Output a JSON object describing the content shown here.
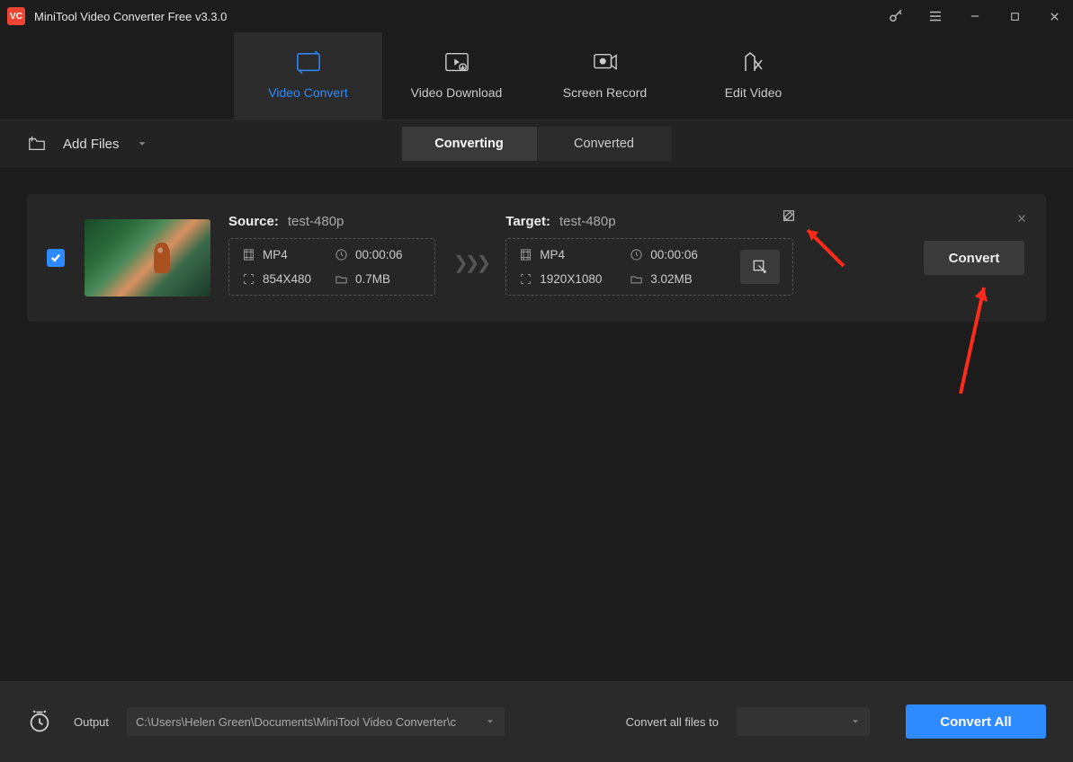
{
  "app": {
    "title": "MiniTool Video Converter Free v3.3.0",
    "logo_text": "VC"
  },
  "nav": {
    "items": [
      {
        "label": "Video Convert"
      },
      {
        "label": "Video Download"
      },
      {
        "label": "Screen Record"
      },
      {
        "label": "Edit Video"
      }
    ]
  },
  "toolbar": {
    "add_files": "Add Files",
    "sub_tabs": {
      "converting": "Converting",
      "converted": "Converted"
    }
  },
  "task": {
    "source_label": "Source:",
    "source_name": "test-480p",
    "source": {
      "format": "MP4",
      "duration": "00:00:06",
      "resolution": "854X480",
      "size": "0.7MB"
    },
    "target_label": "Target:",
    "target_name": "test-480p",
    "target": {
      "format": "MP4",
      "duration": "00:00:06",
      "resolution": "1920X1080",
      "size": "3.02MB"
    },
    "convert_label": "Convert"
  },
  "bottom": {
    "output_label": "Output",
    "output_path": "C:\\Users\\Helen Green\\Documents\\MiniTool Video Converter\\c",
    "convert_files_label": "Convert all files to",
    "convert_all": "Convert All"
  }
}
